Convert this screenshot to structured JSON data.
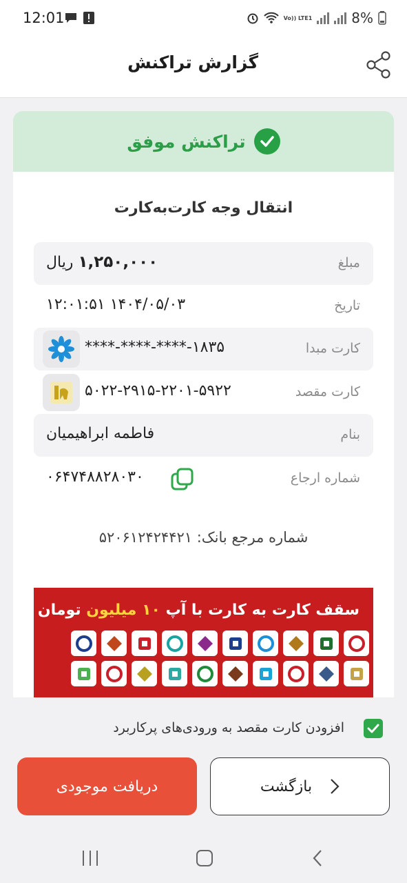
{
  "status_bar": {
    "time": "12:01",
    "battery": "8%",
    "network": "Vo)) LTE1"
  },
  "header": {
    "title": "گزارش تراکنش"
  },
  "banner": {
    "text": "تراکنش موفق"
  },
  "transaction": {
    "type": "انتقال وجه کارت‌به‌کارت",
    "amount_label": "مبلغ",
    "amount_value": "۱,۲۵۰,۰۰۰",
    "amount_unit": "ریال",
    "date_label": "تاریخ",
    "date_value": "۱۲:۰۱:۵۱ ۱۴۰۴/۰۵/۰۳",
    "source_label": "کارت مبدا",
    "source_value": "****-****-****-۱۸۳۵",
    "dest_label": "کارت مقصد",
    "dest_value": "۵۰۲۲-۲۹۱۵-۲۲۰۱-۵۹۲۲",
    "name_label": "بنام",
    "name_value": "فاطمه ابراهیمیان",
    "ref_label": "شماره ارجاع",
    "ref_value": "۰۶۴۷۴۸۸۲۸۰۳۰",
    "bank_ref": "شماره مرجع بانک: ۵۲۰۶۱۲۴۲۴۴۲۱"
  },
  "promo": {
    "title_part1": "سقف کارت به کارت با آپ",
    "title_highlight": "۱۰ میلیون",
    "title_part2": "تومان شد!",
    "bank_colors": [
      "#c8202a",
      "#1f6e2e",
      "#b07a1c",
      "#1d8fd6",
      "#1c3e8c",
      "#8b2a8b",
      "#1aa3a3",
      "#c8202a",
      "#c0461c",
      "#1c3e8c",
      "#c4a24a",
      "#3a5a8a",
      "#c8202a",
      "#1aa3d6",
      "#7a3a1c",
      "#1f8a3a",
      "#2ea8a0",
      "#b8a020",
      "#c8202a",
      "#4caf50",
      "#1a8ac8",
      "#1c3e8c",
      "#c0287a",
      "#e07a1c",
      "#1c3e8c"
    ]
  },
  "checkbox": {
    "label": "افزودن کارت مقصد به ورودی‌های پرکاربرد",
    "checked": true
  },
  "buttons": {
    "primary": "دریافت موجودی",
    "back": "بازگشت"
  }
}
